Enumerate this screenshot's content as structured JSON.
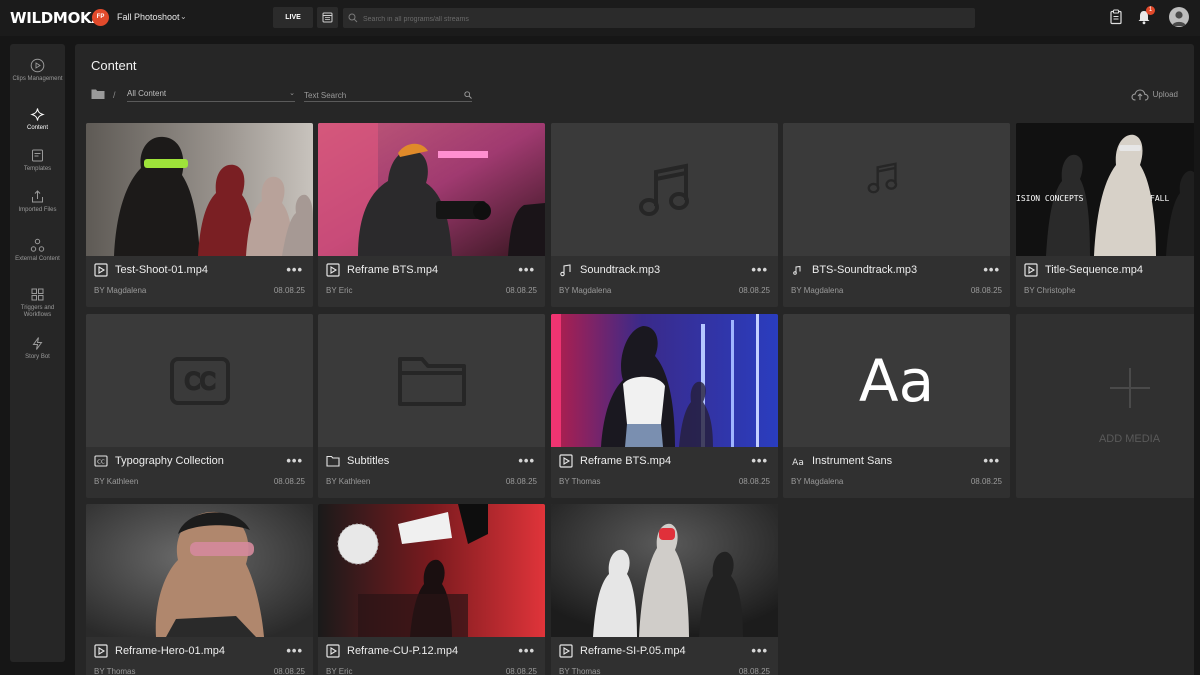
{
  "header": {
    "logo": "WILDMOKA",
    "project_initials": "FP",
    "project_name": "Fall Photoshoot",
    "live_label": "LIVE",
    "search_placeholder": "Search in all programs/all streams",
    "notification_count": "1"
  },
  "sidebar": {
    "items": [
      {
        "label": "Clips Management",
        "icon": "play-circle-icon"
      },
      {
        "label": "Content",
        "icon": "sparkle-icon",
        "active": true
      },
      {
        "label": "Templates",
        "icon": "template-icon"
      },
      {
        "label": "Imported Files",
        "icon": "upload-icon"
      },
      {
        "label": "External Content",
        "icon": "network-icon"
      },
      {
        "label": "Triggers and Workflows",
        "icon": "grid-icon"
      },
      {
        "label": "Story Bot",
        "icon": "lightning-icon"
      }
    ]
  },
  "content": {
    "title": "Content",
    "filter_value": "All Content",
    "text_search_placeholder": "Text Search",
    "upload_label": "Upload",
    "add_media_label": "ADD MEDIA",
    "thumb_overlay_text": {
      "left": "ISION CONCEPTS",
      "right": "FALL"
    },
    "cards": [
      {
        "name": "Test-Shoot-01.mp4",
        "author": "BY Magdalena",
        "date": "08.08.25",
        "type": "video"
      },
      {
        "name": "Reframe BTS.mp4",
        "author": "BY Eric",
        "date": "08.08.25",
        "type": "video"
      },
      {
        "name": "Soundtrack.mp3",
        "author": "BY Magdalena",
        "date": "08.08.25",
        "type": "audio"
      },
      {
        "name": "BTS-Soundtrack.mp3",
        "author": "BY Magdalena",
        "date": "08.08.25",
        "type": "audio"
      },
      {
        "name": "Title-Sequence.mp4",
        "author": "BY Christophe",
        "date": "",
        "type": "video"
      },
      {
        "name": "Typography Collection",
        "author": "BY Kathleen",
        "date": "08.08.25",
        "type": "subtitles"
      },
      {
        "name": "Subtitles",
        "author": "BY Kathleen",
        "date": "08.08.25",
        "type": "folder"
      },
      {
        "name": "Reframe BTS.mp4",
        "author": "BY Thomas",
        "date": "08.08.25",
        "type": "video"
      },
      {
        "name": "Instrument Sans",
        "author": "BY Magdalena",
        "date": "08.08.25",
        "type": "font",
        "preview": "Aa"
      },
      {
        "name": "Reframe-Hero-01.mp4",
        "author": "BY Thomas",
        "date": "08.08.25",
        "type": "video"
      },
      {
        "name": "Reframe-CU-P.12.mp4",
        "author": "BY Eric",
        "date": "08.08.25",
        "type": "video"
      },
      {
        "name": "Reframe-SI-P.05.mp4",
        "author": "BY Thomas",
        "date": "08.08.25",
        "type": "video"
      }
    ]
  },
  "colors": {
    "accent": "#e24a2b",
    "bg": "#161616",
    "panel": "#262626",
    "card": "#303030"
  }
}
